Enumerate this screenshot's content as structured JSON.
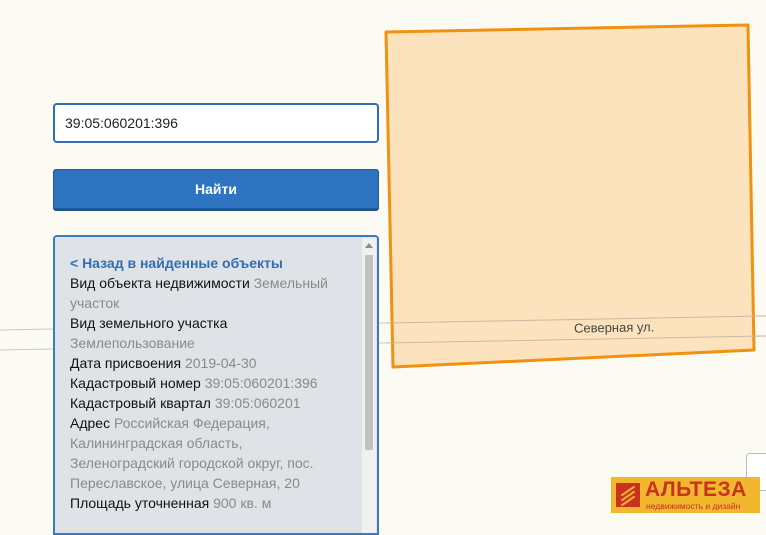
{
  "search": {
    "value": "39:05:060201:396",
    "button_label": "Найти"
  },
  "panel": {
    "back_link": "< Назад в найденные объекты",
    "fields": [
      {
        "label": "Вид объекта недвижимости",
        "value": "Земельный участок"
      },
      {
        "label": "Вид земельного участка",
        "value": "Землепользование"
      },
      {
        "label": "Дата присвоения",
        "value": "2019-04-30"
      },
      {
        "label": "Кадастровый номер",
        "value": "39:05:060201:396"
      },
      {
        "label": "Кадастровый квартал",
        "value": "39:05:060201"
      },
      {
        "label": "Адрес",
        "value": "Российская Федерация, Калининградская область, Зеленоградский городской округ, пос. Переславское, улица Северная, 20"
      },
      {
        "label": "Площадь уточненная",
        "value": "900 кв. м"
      }
    ]
  },
  "map": {
    "street_label": "Северная ул.",
    "parcel_fill": "#fde3bd",
    "parcel_stroke": "#f0920f"
  },
  "logo": {
    "title": "АЛЬТЕЗА",
    "subtitle": "недвижимость и дизайн",
    "colors": {
      "background": "#f2b72f",
      "text": "#c8321e"
    }
  }
}
